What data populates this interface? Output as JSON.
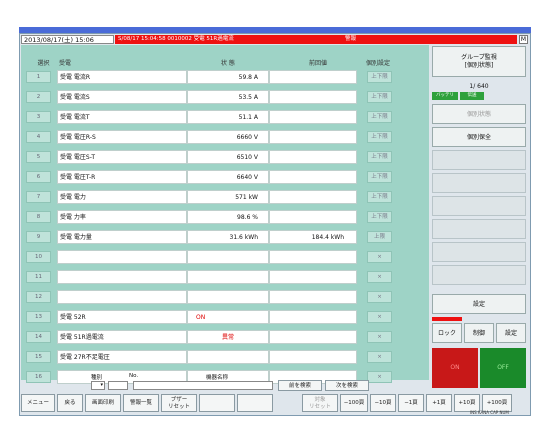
{
  "status": {
    "datetime": "2013/08/17(土) 15:06",
    "alarm_message": "S/08/17 15:04:58 0010002 受電 51R過電流",
    "alarm_label": "警報",
    "close_glyph": "M"
  },
  "headers": {
    "select": "選択",
    "name": "受電",
    "state": "状 態",
    "prev": "前回値",
    "individual": "個別設定"
  },
  "rows": [
    {
      "no": "1",
      "name": "受電 電流R",
      "state": "59.8 A",
      "prev": "",
      "ind": "上下限"
    },
    {
      "no": "2",
      "name": "受電 電流S",
      "state": "53.5 A",
      "prev": "",
      "ind": "上下限"
    },
    {
      "no": "3",
      "name": "受電 電流T",
      "state": "51.1 A",
      "prev": "",
      "ind": "上下限"
    },
    {
      "no": "4",
      "name": "受電 電圧R-S",
      "state": "6660 V",
      "prev": "",
      "ind": "上下限"
    },
    {
      "no": "5",
      "name": "受電 電圧S-T",
      "state": "6510 V",
      "prev": "",
      "ind": "上下限"
    },
    {
      "no": "6",
      "name": "受電 電圧T-R",
      "state": "6640 V",
      "prev": "",
      "ind": "上下限"
    },
    {
      "no": "7",
      "name": "受電 電力",
      "state": "571 kW",
      "prev": "",
      "ind": "上下限"
    },
    {
      "no": "8",
      "name": "受電 力率",
      "state": "98.6 %",
      "prev": "",
      "ind": "上下限"
    },
    {
      "no": "9",
      "name": "受電 電力量",
      "state": "31.6 kWh",
      "prev": "184.4 kWh",
      "ind": "上限"
    },
    {
      "no": "10",
      "name": "",
      "state": "",
      "prev": "",
      "ind": "×"
    },
    {
      "no": "11",
      "name": "",
      "state": "",
      "prev": "",
      "ind": "×"
    },
    {
      "no": "12",
      "name": "",
      "state": "",
      "prev": "",
      "ind": "×"
    },
    {
      "no": "13",
      "name": "受電 52R",
      "state": "ON",
      "prev": "",
      "ind": "×"
    },
    {
      "no": "14",
      "name": "受電 51R過電流",
      "state": "異常",
      "prev": "",
      "ind": "×"
    },
    {
      "no": "15",
      "name": "受電 27R不足電圧",
      "state": "",
      "prev": "",
      "ind": "×"
    },
    {
      "no": "16",
      "name": "",
      "state": "",
      "prev": "",
      "ind": "×"
    }
  ],
  "search": {
    "type_label": "種別",
    "no_label": "No.",
    "device_label": "機器名称",
    "prev_search": "前を検索",
    "next_search": "次を検索"
  },
  "right_panel": {
    "group_title_1": "グループ監視",
    "group_title_2": "[個別状態]",
    "page": "1/ 640",
    "battery": "バッテリ",
    "comm": "伝送",
    "individual_state": "個別状態",
    "individual_save": "個別保全",
    "settings": "設定",
    "lock": "ロック",
    "control": "制御",
    "setting2": "設定",
    "on": "ON",
    "off": "OFF"
  },
  "bottom": {
    "menu": "メニュー",
    "back": "戻る",
    "print": "画面印刷",
    "alarm_list": "警報一覧",
    "buzzer_1": "ブザー",
    "buzzer_2": "リセット",
    "target_1": "対象",
    "target_2": "リセット",
    "m100": "−100頁",
    "m10": "−10頁",
    "m1": "−1頁",
    "p1": "+1頁",
    "p10": "+10頁",
    "p100": "+100頁"
  },
  "footer_tiny": "INS KANA CAP NUM"
}
